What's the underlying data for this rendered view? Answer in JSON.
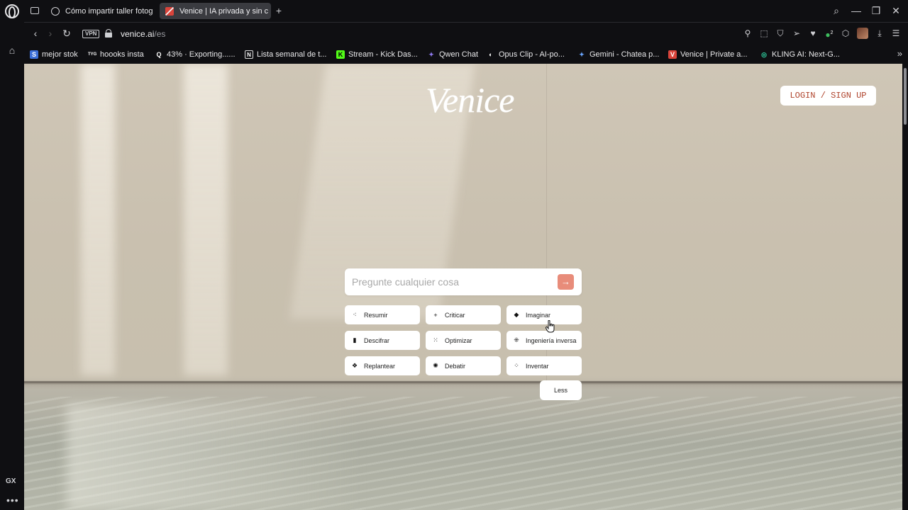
{
  "browser": {
    "tabs": [
      {
        "label": "Cómo impartir taller fotog",
        "active": false
      },
      {
        "label": "Venice | IA privada y sin c",
        "active": true
      }
    ],
    "new_tab": "+",
    "url": {
      "host": "venice.ai",
      "path": "/es"
    },
    "vpn_label": "VPN",
    "sidebar_label": "GX",
    "sidebar_more": "•••",
    "extension_badge": "2"
  },
  "bookmarks": [
    {
      "label": "mejor stok",
      "icon": "S",
      "color": "#3b6fd8"
    },
    {
      "label": "hoooks insta",
      "icon": "TYG",
      "color": "#0f0f12"
    },
    {
      "label": "43% · Exporting......",
      "icon": "Q",
      "color": "#0f0f12"
    },
    {
      "label": "Lista semanal de t...",
      "icon": "N",
      "color": "#0f0f12"
    },
    {
      "label": "Stream - Kick Das...",
      "icon": "K",
      "color": "#53fc18"
    },
    {
      "label": "Qwen Chat",
      "icon": "✦",
      "color": "#6b4fd8"
    },
    {
      "label": "Opus Clip - AI-po...",
      "icon": "◐",
      "color": "#0f0f12"
    },
    {
      "label": "Gemini - Chatea p...",
      "icon": "✦",
      "color": "#4a8cf0"
    },
    {
      "label": "Venice | Private a...",
      "icon": "V",
      "color": "#d9443b"
    },
    {
      "label": "KLING AI: Next-G...",
      "icon": "◎",
      "color": "#2fd0a0"
    }
  ],
  "page": {
    "logo": "Venice",
    "login_label": "LOGIN / SIGN UP",
    "prompt_placeholder": "Pregunte cualquier cosa",
    "send_icon": "→",
    "chips": [
      {
        "label": "Resumir",
        "icon": "⁖"
      },
      {
        "label": "Criticar",
        "icon": "+"
      },
      {
        "label": "Imaginar",
        "icon": "◆"
      },
      {
        "label": "Descifrar",
        "icon": "▮"
      },
      {
        "label": "Optimizar",
        "icon": "⁙"
      },
      {
        "label": "Ingeniería inversa",
        "icon": "⁜"
      },
      {
        "label": "Replantear",
        "icon": "❖"
      },
      {
        "label": "Debatir",
        "icon": "✺"
      },
      {
        "label": "Inventar",
        "icon": "⁘"
      }
    ],
    "less_label": "Less"
  }
}
